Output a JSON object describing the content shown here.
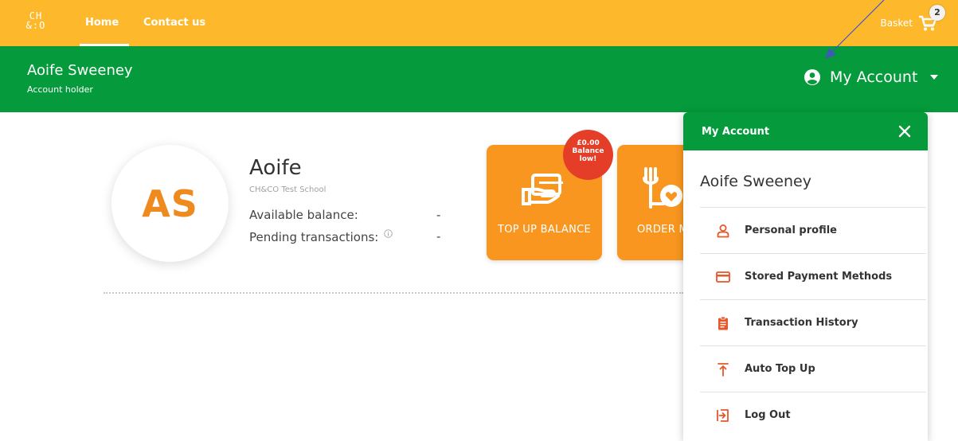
{
  "nav": {
    "logo_line1": "CH",
    "logo_line2": "&:O",
    "home": "Home",
    "contact": "Contact us",
    "basket": "Basket",
    "basket_count": "2"
  },
  "header": {
    "name": "Aoife Sweeney",
    "role": "Account holder",
    "my_account": "My Account"
  },
  "profile": {
    "initials": "AS",
    "first_name": "Aoife",
    "school": "CH&CO Test School",
    "available_label": "Available balance:",
    "available_value": "-",
    "pending_label": "Pending transactions:",
    "pending_value": "-"
  },
  "tiles": {
    "topup_label": "TOP UP BALANCE",
    "order_label": "ORDER M",
    "badge_amount": "£0.00",
    "badge_line2": "Balance",
    "badge_line3": "low!"
  },
  "panel": {
    "title": "My Account",
    "user": "Aoife Sweeney",
    "items": [
      {
        "label": "Personal profile",
        "icon": "person-icon"
      },
      {
        "label": "Stored Payment Methods",
        "icon": "credit-card-icon"
      },
      {
        "label": "Transaction History",
        "icon": "clipboard-icon"
      },
      {
        "label": "Auto Top Up",
        "icon": "arrow-up-bar-icon"
      },
      {
        "label": "Log Out",
        "icon": "logout-icon"
      }
    ]
  },
  "colors": {
    "brand_yellow": "#fdb92b",
    "brand_green": "#059a3b",
    "tile_orange": "#f8961f",
    "badge_red": "#e53e28",
    "icon_orange": "#e8562a"
  }
}
